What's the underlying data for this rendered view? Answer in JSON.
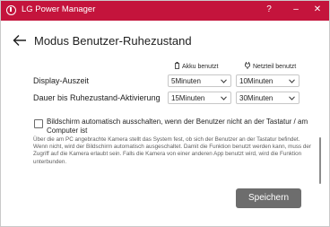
{
  "window": {
    "title": "LG Power Manager",
    "help_glyph": "?",
    "minimize_glyph": "–",
    "close_glyph": "✕",
    "accent_color": "#c4143c"
  },
  "page": {
    "heading": "Modus Benutzer-Ruhezustand",
    "back_icon": "back-arrow-icon"
  },
  "columns": {
    "battery": {
      "icon": "battery-icon",
      "label": "Akku benutzt"
    },
    "plugged": {
      "icon": "plug-icon",
      "label": "Netzteil benutzt"
    }
  },
  "rows": [
    {
      "label": "Display-Auszeit",
      "battery_value": "5Minuten",
      "plugged_value": "10Minuten"
    },
    {
      "label": "Dauer bis Ruhezustand-Aktivierung",
      "battery_value": "15Minuten",
      "plugged_value": "30Minuten"
    }
  ],
  "camera_option": {
    "checked": false,
    "label": "Bildschirm automatisch ausschalten, wenn der Benutzer nicht an der Tastatur / am Computer ist",
    "description": "Über die am PC angebrachte Kamera stellt das System fest, ob sich der Benutzer an der Tastatur befindet. Wenn nicht, wird der Bildschirm automatisch ausgeschaltet. Damit die Funktion benutzt werden kann, muss der Zugriff auf die Kamera erlaubt sein. Falls die Kamera von einer anderen App benutzt wird, wird die Funktion unterbunden."
  },
  "actions": {
    "save_label": "Speichern"
  }
}
